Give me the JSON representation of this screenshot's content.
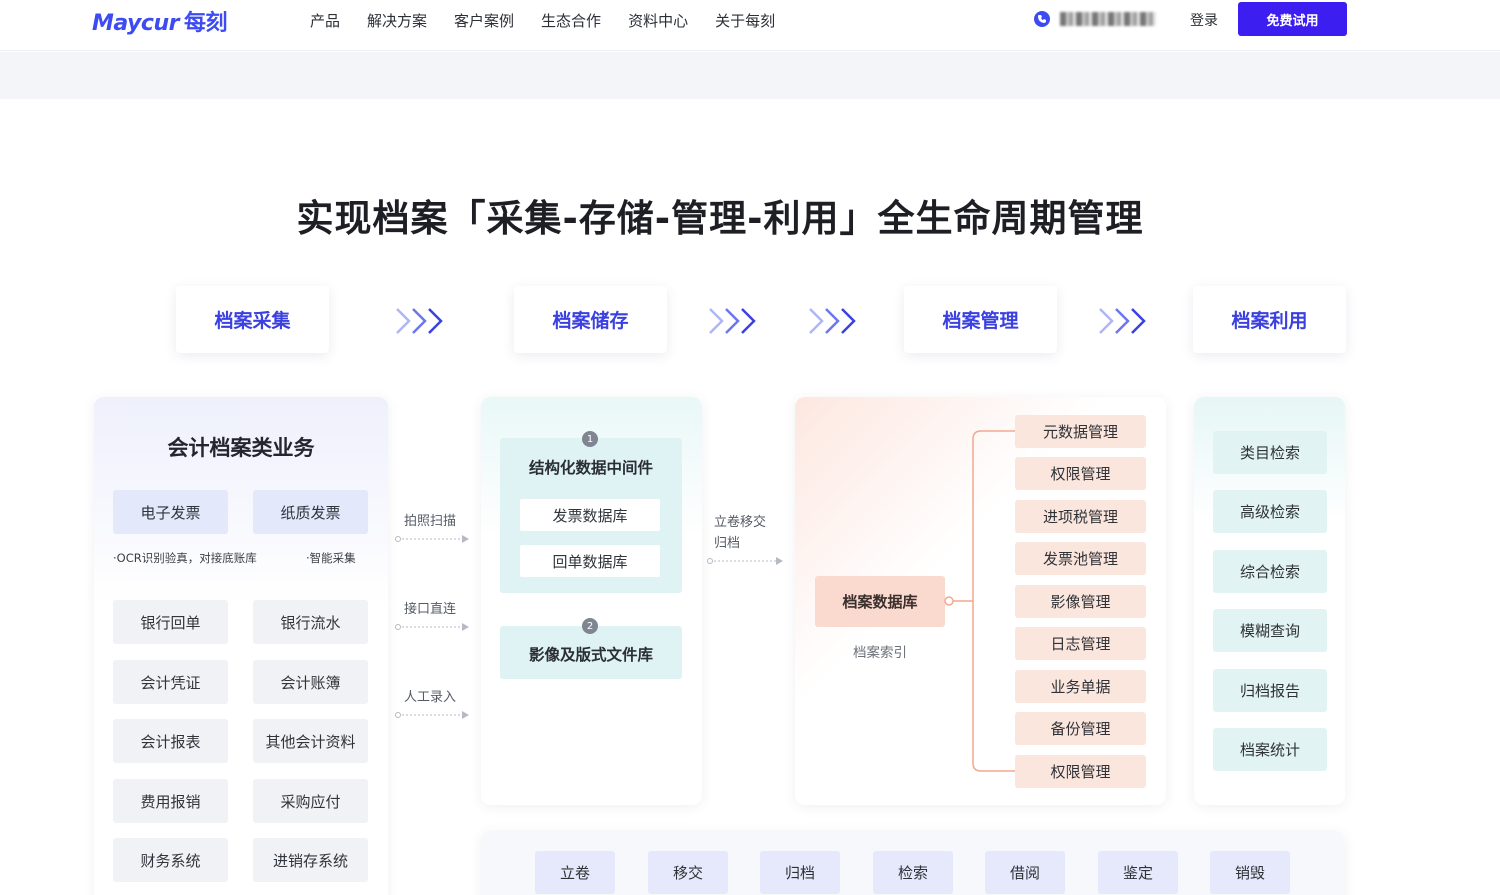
{
  "nav": {
    "logo_text": "Maycur",
    "logo_cn": "每刻",
    "items": [
      "产品",
      "解决方案",
      "客户案例",
      "生态合作",
      "资料中心",
      "关于每刻"
    ],
    "login": "登录",
    "trial": "免费试用",
    "phone_icon": "phone-icon"
  },
  "page": {
    "title": "实现档案「采集-存储-管理-利用」全生命周期管理"
  },
  "stages": [
    "档案采集",
    "档案储存",
    "档案管理",
    "档案利用"
  ],
  "accounting": {
    "title": "会计档案类业务",
    "top_chips": [
      "电子发票",
      "纸质发票"
    ],
    "note_left": "·OCR识别验真，对接底账库",
    "note_right": "·智能采集",
    "chips": [
      "银行回单",
      "银行流水",
      "会计凭证",
      "会计账簿",
      "会计报表",
      "其他会计资料",
      "费用报销",
      "采购应付",
      "财务系统",
      "进销存系统"
    ]
  },
  "collect_methods": [
    "拍照扫描",
    "接口直连",
    "人工录入"
  ],
  "storage": {
    "step1_num": "1",
    "step1_title": "结构化数据中间件",
    "step1_items": [
      "发票数据库",
      "回单数据库"
    ],
    "step2_num": "2",
    "step2_title": "影像及版式文件库"
  },
  "transfer_label": [
    "立卷移交",
    "归档"
  ],
  "management": {
    "db_title": "档案数据库",
    "db_sub": "档案索引",
    "items": [
      "元数据管理",
      "权限管理",
      "进项税管理",
      "发票池管理",
      "影像管理",
      "日志管理",
      "业务单据",
      "备份管理",
      "权限管理"
    ]
  },
  "usage": {
    "items": [
      "类目检索",
      "高级检索",
      "综合检索",
      "模糊查询",
      "归档报告",
      "档案统计"
    ]
  },
  "lifecycle": [
    "立卷",
    "移交",
    "归档",
    "检索",
    "借阅",
    "鉴定",
    "销毁"
  ],
  "colors": {
    "brand": "#3d4cf2",
    "trial_button": "#3d1ef0",
    "stage_text": "#3b41e0"
  }
}
